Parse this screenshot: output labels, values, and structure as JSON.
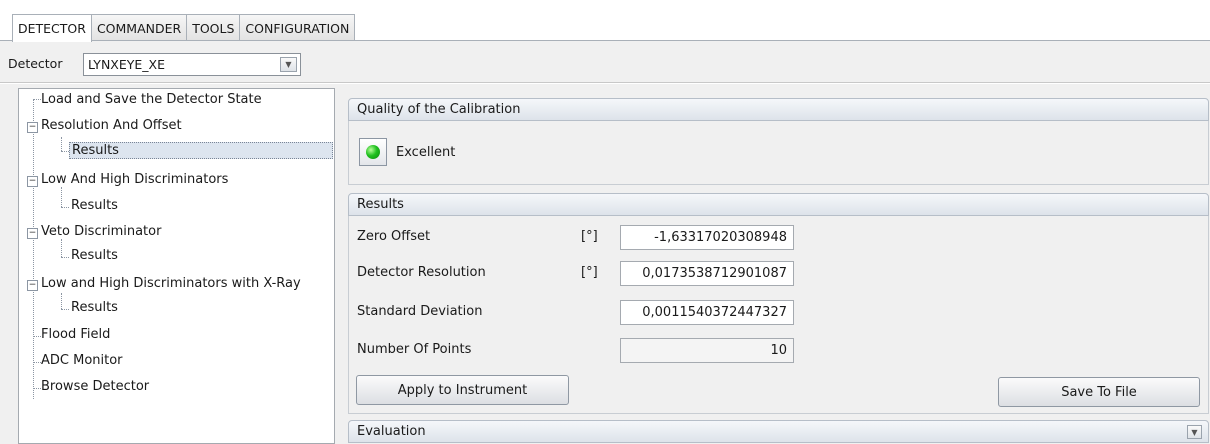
{
  "tabs": [
    "DETECTOR",
    "COMMANDER",
    "TOOLS",
    "CONFIGURATION"
  ],
  "detector": {
    "label": "Detector",
    "value": "LYNXEYE_XE"
  },
  "tree": {
    "items": [
      "Load and Save the Detector State",
      "Resolution And Offset",
      "Results",
      "Low And High Discriminators",
      "Results",
      "Veto Discriminator",
      "Results",
      "Low and High Discriminators with X-Ray",
      "Results",
      "Flood Field",
      "ADC Monitor",
      "Browse Detector"
    ],
    "expander": "−"
  },
  "quality": {
    "title": "Quality of the Calibration",
    "status": "Excellent",
    "status_color": "#20c020"
  },
  "results": {
    "title": "Results",
    "rows": [
      {
        "label": "Zero Offset",
        "unit": "[°]",
        "value": "-1,63317020308948"
      },
      {
        "label": "Detector Resolution",
        "unit": "[°]",
        "value": "0,0173538712901087"
      },
      {
        "label": "Standard Deviation",
        "unit": "",
        "value": "0,0011540372447327"
      },
      {
        "label": "Number Of Points",
        "unit": "",
        "value": "10"
      }
    ],
    "apply_label": "Apply to Instrument",
    "save_label": "Save To File"
  },
  "evaluation": {
    "title": "Evaluation"
  },
  "icons": {
    "dropdown": "chevron-down-icon",
    "collapse": "chevron-down-icon"
  }
}
